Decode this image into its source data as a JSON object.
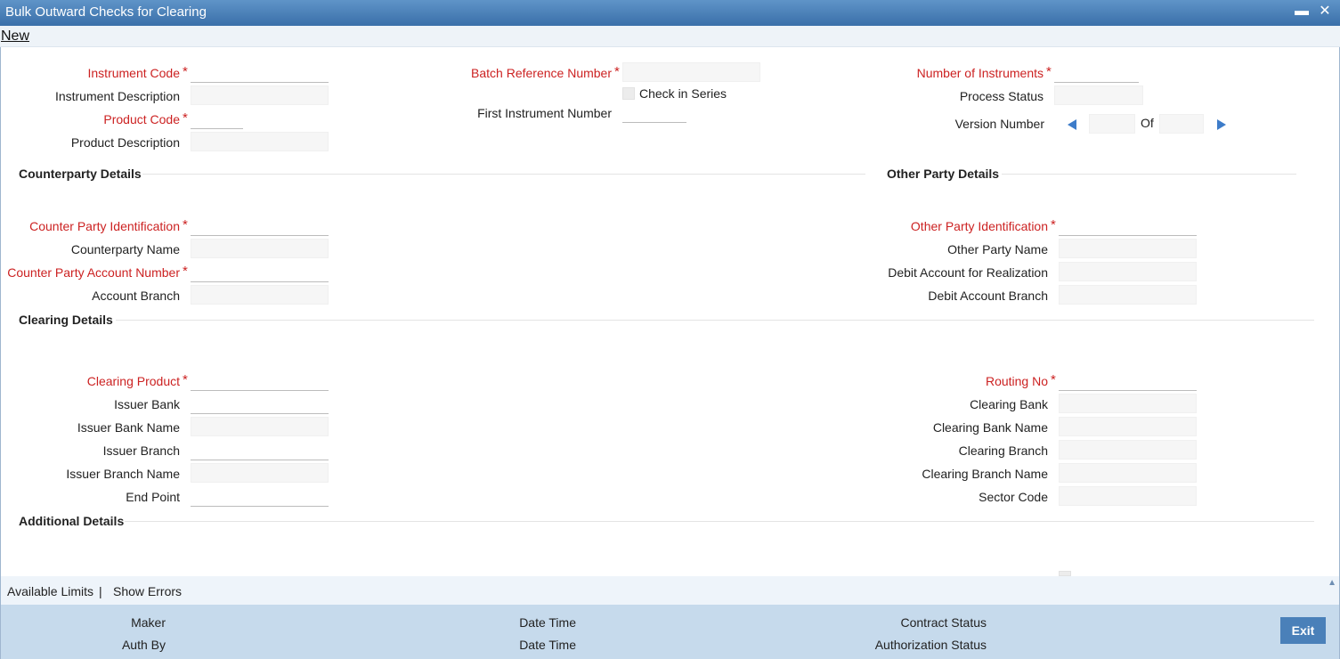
{
  "window": {
    "title": "Bulk Outward Checks for Clearing",
    "minimize_glyph": "▬",
    "close_glyph": "✕"
  },
  "toolbar": {
    "new_label": "New"
  },
  "header_fields": {
    "instrument_code": "Instrument Code",
    "instrument_description": "Instrument Description",
    "product_code": "Product Code",
    "product_description": "Product Description",
    "batch_reference_number": "Batch Reference Number",
    "check_in_series": "Check in Series",
    "first_instrument_number": "First Instrument Number",
    "number_of_instruments": "Number of Instruments",
    "process_status": "Process Status",
    "version_number": "Version Number",
    "of_label": "Of"
  },
  "counterparty": {
    "title": "Counterparty Details",
    "identification": "Counter Party Identification",
    "name": "Counterparty Name",
    "account_number": "Counter Party Account Number",
    "account_branch": "Account Branch"
  },
  "other_party": {
    "title": "Other Party Details",
    "identification": "Other Party Identification",
    "name": "Other Party Name",
    "debit_account": "Debit Account for Realization",
    "debit_branch": "Debit Account Branch"
  },
  "clearing": {
    "title": "Clearing Details",
    "clearing_product": "Clearing Product",
    "issuer_bank": "Issuer Bank",
    "issuer_bank_name": "Issuer Bank Name",
    "issuer_branch": "Issuer Branch",
    "issuer_branch_name": "Issuer Branch Name",
    "end_point": "End Point",
    "routing_no": "Routing No",
    "clearing_bank": "Clearing Bank",
    "clearing_bank_name": "Clearing Bank Name",
    "clearing_branch": "Clearing Branch",
    "clearing_branch_name": "Clearing Branch Name",
    "sector_code": "Sector Code"
  },
  "additional": {
    "title": "Additional Details"
  },
  "links": {
    "available_limits": "Available Limits",
    "separator": "|",
    "show_errors": "Show Errors"
  },
  "footer": {
    "maker": "Maker",
    "auth_by": "Auth By",
    "date_time_1": "Date Time",
    "date_time_2": "Date Time",
    "contract_status": "Contract Status",
    "authorization_status": "Authorization Status",
    "exit_label": "Exit"
  },
  "colors": {
    "title_bar": "#3a6fa9",
    "required_label": "#cc2222",
    "footer_bg": "#c6daec",
    "exit_button": "#4a80b9",
    "nav_arrow": "#3d7cc9"
  },
  "required_marker": "*"
}
